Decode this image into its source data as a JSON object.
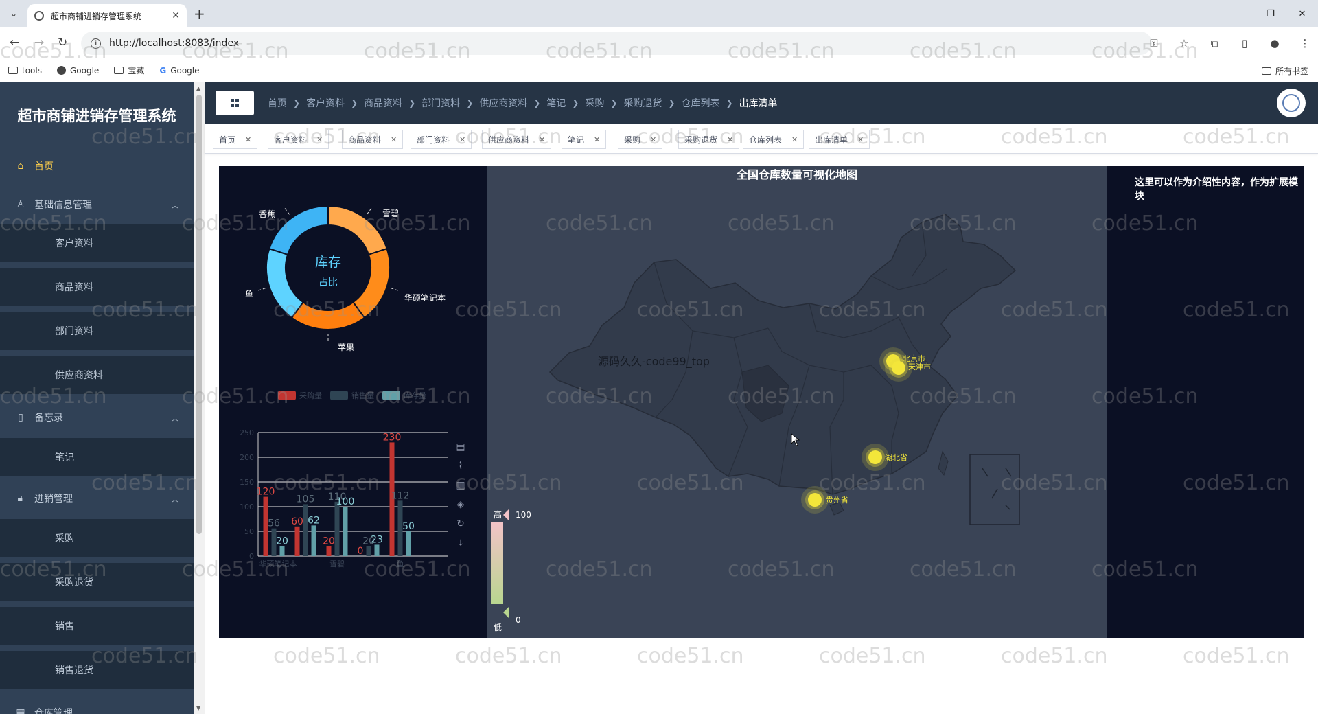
{
  "browser": {
    "tab_title": "超市商铺进销存管理系统",
    "url": "http://localhost:8083/index",
    "bookmarks": [
      "tools",
      "Google",
      "宝藏",
      "Google"
    ],
    "all_bookmarks": "所有书签"
  },
  "app": {
    "title": "超市商铺进销存管理系统",
    "menu": {
      "home": "首页",
      "basic_info": "基础信息管理",
      "customer": "客户资料",
      "goods": "商品资料",
      "department": "部门资料",
      "supplier": "供应商资料",
      "memo": "备忘录",
      "notes": "笔记",
      "trade": "进销管理",
      "purchase": "采购",
      "purchase_return": "采购退货",
      "sales": "销售",
      "sales_return": "销售退货",
      "warehouse": "仓库管理"
    },
    "breadcrumbs": [
      "首页",
      "客户资料",
      "商品资料",
      "部门资料",
      "供应商资料",
      "笔记",
      "采购",
      "采购退货",
      "仓库列表",
      "出库清单"
    ],
    "tags": [
      "首页",
      "客户资料",
      "商品资料",
      "部门资料",
      "供应商资料",
      "笔记",
      "采购",
      "采购退货",
      "仓库列表",
      "出库清单"
    ]
  },
  "dashboard": {
    "intro_text": "这里可以作为介绍性内容，作为扩展模块",
    "donut": {
      "center_title": "库存",
      "center_subtitle": "占比",
      "slices": [
        {
          "name": "雪碧",
          "value": 20,
          "color": "#ffa94d"
        },
        {
          "name": "华硕笔记本",
          "value": 20,
          "color": "#ff8c1a"
        },
        {
          "name": "苹果",
          "value": 20,
          "color": "#ff7f0e"
        },
        {
          "name": "鱼",
          "value": 20,
          "color": "#5ed3ff"
        },
        {
          "name": "香蕉",
          "value": 20,
          "color": "#3eb4f5"
        }
      ]
    },
    "map": {
      "title": "全国仓库数量可视化地图",
      "watermark_label": "源码久久-code99_top",
      "visual_map": {
        "high_label": "高",
        "low_label": "低",
        "max": "100",
        "min": "0"
      },
      "points": [
        {
          "name": "北京市"
        },
        {
          "name": "天津市"
        },
        {
          "name": "湖北省"
        },
        {
          "name": "贵州省"
        }
      ]
    }
  },
  "chart_data": {
    "type": "bar",
    "categories": [
      "华硕笔记本",
      "雪碧",
      "鱼"
    ],
    "series": [
      {
        "name": "采购量",
        "color": "#c23531",
        "values": [
          120,
          60,
          20,
          0,
          230,
          0
        ]
      },
      {
        "name": "销售量",
        "color": "#2f4554",
        "values": [
          56,
          105,
          110,
          20,
          112,
          0
        ]
      },
      {
        "name": "库存量",
        "color": "#61a0a8",
        "values": [
          20,
          62,
          100,
          23,
          50,
          0
        ]
      }
    ],
    "slots": [
      "华硕笔记本",
      "",
      "雪碧",
      "",
      "鱼",
      ""
    ],
    "ylim": [
      0,
      250
    ],
    "yticks": [
      0,
      50,
      100,
      150,
      200,
      250
    ],
    "legend": "top",
    "grid": true
  },
  "watermark": "code51.cn"
}
